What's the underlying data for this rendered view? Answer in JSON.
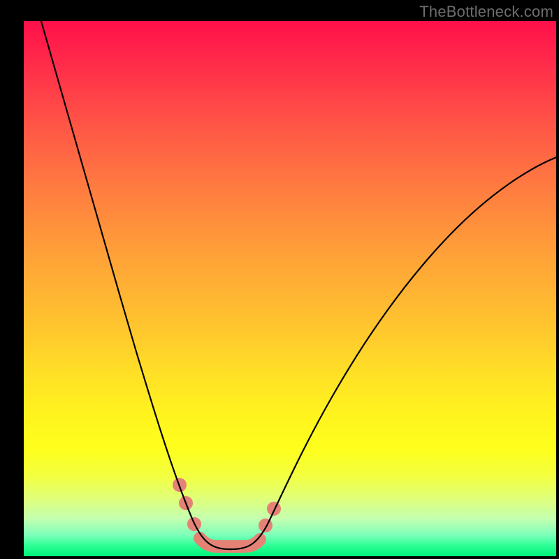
{
  "watermark": "TheBottleneck.com",
  "chart_data": {
    "type": "line",
    "title": "",
    "xlabel": "",
    "ylabel": "",
    "xlim": [
      0,
      100
    ],
    "ylim": [
      0,
      100
    ],
    "gradient_meaning": "vertical color scale from red (top, high bottleneck) to green (bottom, low bottleneck)",
    "series": [
      {
        "name": "bottleneck-curve",
        "x": [
          0,
          5,
          10,
          15,
          20,
          25,
          28,
          30,
          32,
          34,
          36,
          38,
          40,
          42,
          45,
          50,
          55,
          60,
          65,
          70,
          75,
          80,
          85,
          90,
          95,
          100
        ],
        "y": [
          98,
          88,
          76,
          64,
          50,
          34,
          22,
          14,
          8,
          4,
          2.5,
          2,
          2,
          2.5,
          5,
          12,
          21,
          30,
          38,
          46,
          53,
          59,
          64,
          68,
          71,
          73
        ]
      }
    ],
    "marker_points": {
      "name": "highlighted-minimum-region",
      "x": [
        30,
        32,
        35,
        38,
        40,
        42,
        45
      ],
      "y": [
        14,
        8,
        4,
        2,
        2,
        2.5,
        5
      ]
    }
  }
}
